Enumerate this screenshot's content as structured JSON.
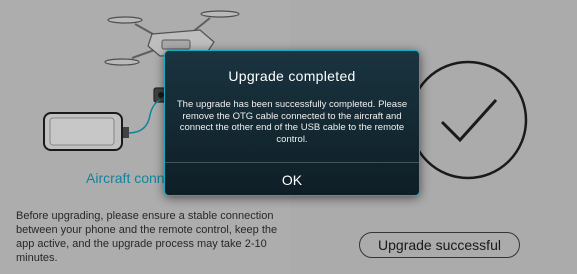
{
  "left_panel": {
    "connection_status": "Aircraft connected",
    "instructions": "Before upgrading, please ensure a stable connection between your phone and the remote control, keep the app active, and the upgrade process may take 2-10 minutes."
  },
  "right_panel": {
    "status_label": "Upgrade successful"
  },
  "dialog": {
    "title": "Upgrade completed",
    "message": "The upgrade has been successfully completed. Please remove the OTG cable connected to the aircraft and connect the other end of the USB cable to the remote control.",
    "ok_label": "OK"
  },
  "colors": {
    "accent": "#18a9c9",
    "dialog_background": "#13252e"
  },
  "icons": [
    "drone-icon",
    "phone-icon",
    "usb-cable-icon",
    "checkmark-circle-icon"
  ]
}
